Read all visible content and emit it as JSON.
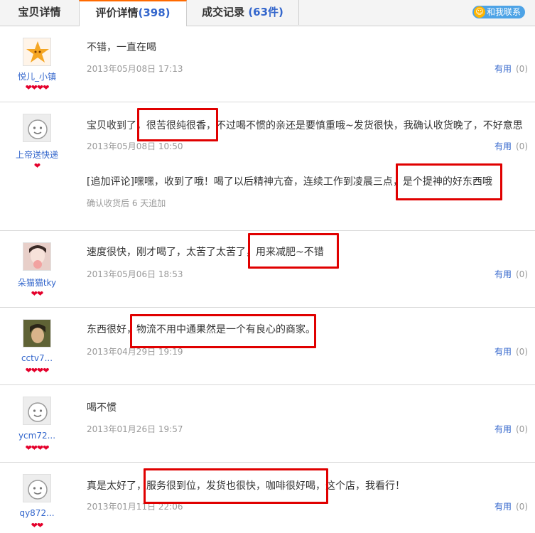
{
  "tabs": [
    {
      "label": "宝贝详情",
      "count": ""
    },
    {
      "label": "评价详情",
      "count": "(398)"
    },
    {
      "label": "成交记录",
      "count": "(63件)"
    }
  ],
  "contact_label": "和我联系",
  "helpful_label": "有用",
  "reviews": [
    {
      "user": "悦儿_小镇",
      "rank": "❤❤❤❤",
      "content": "不错，一直在喝",
      "date": "2013年05月08日 17:13",
      "helpful": "(0)"
    },
    {
      "user": "上帝送快递",
      "rank": "❤",
      "content": "宝贝收到了，很苦很纯很香，不过喝不惯的亲还是要慎重哦~发货很快，我确认收货晚了，不好意思",
      "date": "2013年05月08日 10:50",
      "helpful": "(0)",
      "followup": "[追加评论]嘿嘿，收到了哦！喝了以后精神亢奋，连续工作到凌晨三点，是个提神的好东西哦",
      "followup_note": "确认收货后 6 天追加"
    },
    {
      "user": "朵猫猫tky",
      "rank": "❤❤",
      "content": "速度很快，刚才喝了，太苦了太苦了，用来减肥~不错",
      "date": "2013年05月06日 18:53",
      "helpful": "(0)"
    },
    {
      "user": "cctv7...",
      "rank": "❤❤❤❤",
      "content": "东西很好，物流不用中通果然是一个有良心的商家。",
      "date": "2013年04月29日 19:19",
      "helpful": "(0)"
    },
    {
      "user": "ycm72...",
      "rank": "❤❤❤❤",
      "content": "喝不惯",
      "date": "2013年01月26日 19:57",
      "helpful": "(0)"
    },
    {
      "user": "qy872...",
      "rank": "❤❤",
      "content": "真是太好了，服务很到位，发货也很快，咖啡很好喝，这个店，我看行！",
      "date": "2013年01月11日 22:06",
      "helpful": "(0)"
    }
  ]
}
